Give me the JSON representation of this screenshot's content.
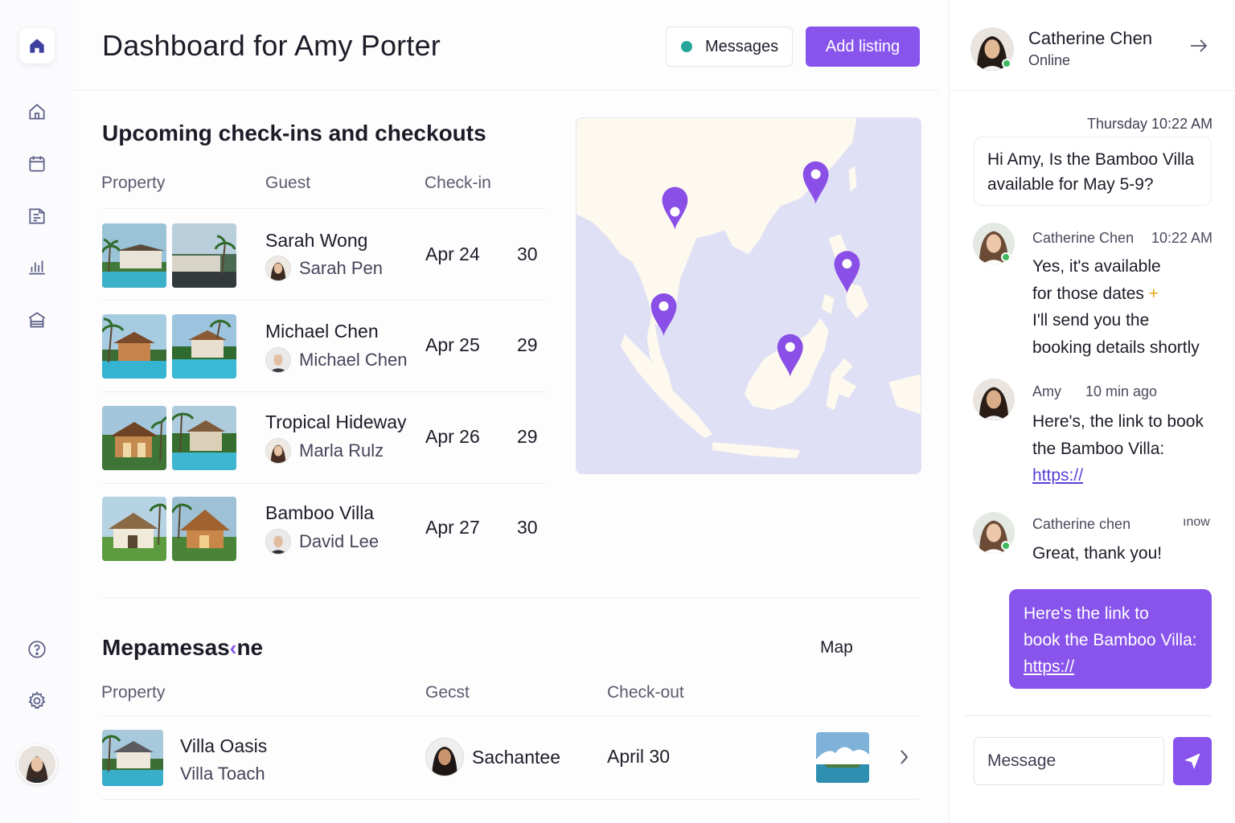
{
  "rail": {
    "icons": [
      "home-filled-icon",
      "home-icon",
      "calendar-icon",
      "listing-icon",
      "analytics-icon",
      "property-icon",
      "help-icon",
      "settings-icon"
    ]
  },
  "header": {
    "title": "Dashboard for Amy Porter",
    "messages_label": "Messages",
    "add_listing_label": "Add listing"
  },
  "upcoming": {
    "title": "Upcoming check-ins and checkouts",
    "columns": [
      "Property",
      "Guest",
      "Check-in"
    ],
    "rows": [
      {
        "property": "Sarah Wong",
        "guest": "Sarah Pen",
        "checkin": "Apr 24",
        "num": "30"
      },
      {
        "property": "Michael Chen",
        "guest": "Michael Chen",
        "checkin": "Apr 25",
        "num": "29"
      },
      {
        "property": "Tropical Hideway",
        "guest": "Marla Rulz",
        "checkin": "Apr 26",
        "num": "29"
      },
      {
        "property": "Bamboo Villa",
        "guest": "David Lee",
        "checkin": "Apr 27",
        "num": "30"
      }
    ]
  },
  "checkouts": {
    "title": "Mepamesas",
    "title_tail": "ne",
    "map_label": "Map",
    "columns": [
      "Property",
      "Gecst",
      "Check-out"
    ],
    "rows": [
      {
        "property": "Villa Oasis",
        "sub": "Villa Toach",
        "guest": "Sachantee",
        "checkout": "April 30"
      }
    ]
  },
  "chat": {
    "contact_name": "Catherine Chen",
    "contact_status": "Online",
    "first_timestamp": "Thursday 10:22 AM",
    "first_message": "Hi Amy, Is the Bamboo Villa available for May 5-9?",
    "messages": [
      {
        "sender": "Catherine Chen",
        "time": "10:22 AM",
        "lines": [
          "Yes, it's available",
          "for those dates",
          "I'll send you the",
          "booking details shortly"
        ],
        "plus": "+"
      },
      {
        "sender": "Amy",
        "time": "10 min ago",
        "lines": [
          "Here's, the link to book",
          "the Bamboo Villa:"
        ],
        "link": "https://"
      },
      {
        "sender": "Catherine  chen",
        "time": "ınow",
        "lines": [
          "Great, thank you!"
        ]
      }
    ],
    "outgoing": {
      "lines": [
        "Here's the link to",
        "book the Bamboo Villa:"
      ],
      "link": "https://"
    },
    "input_placeholder": "Message"
  },
  "colors": {
    "accent": "#8854ec",
    "status_dot": "#26a59a",
    "online": "#3fb85f",
    "map_water": "#dfe0f5",
    "map_land": "#fdf9ef",
    "pin": "#8a4fe6"
  }
}
